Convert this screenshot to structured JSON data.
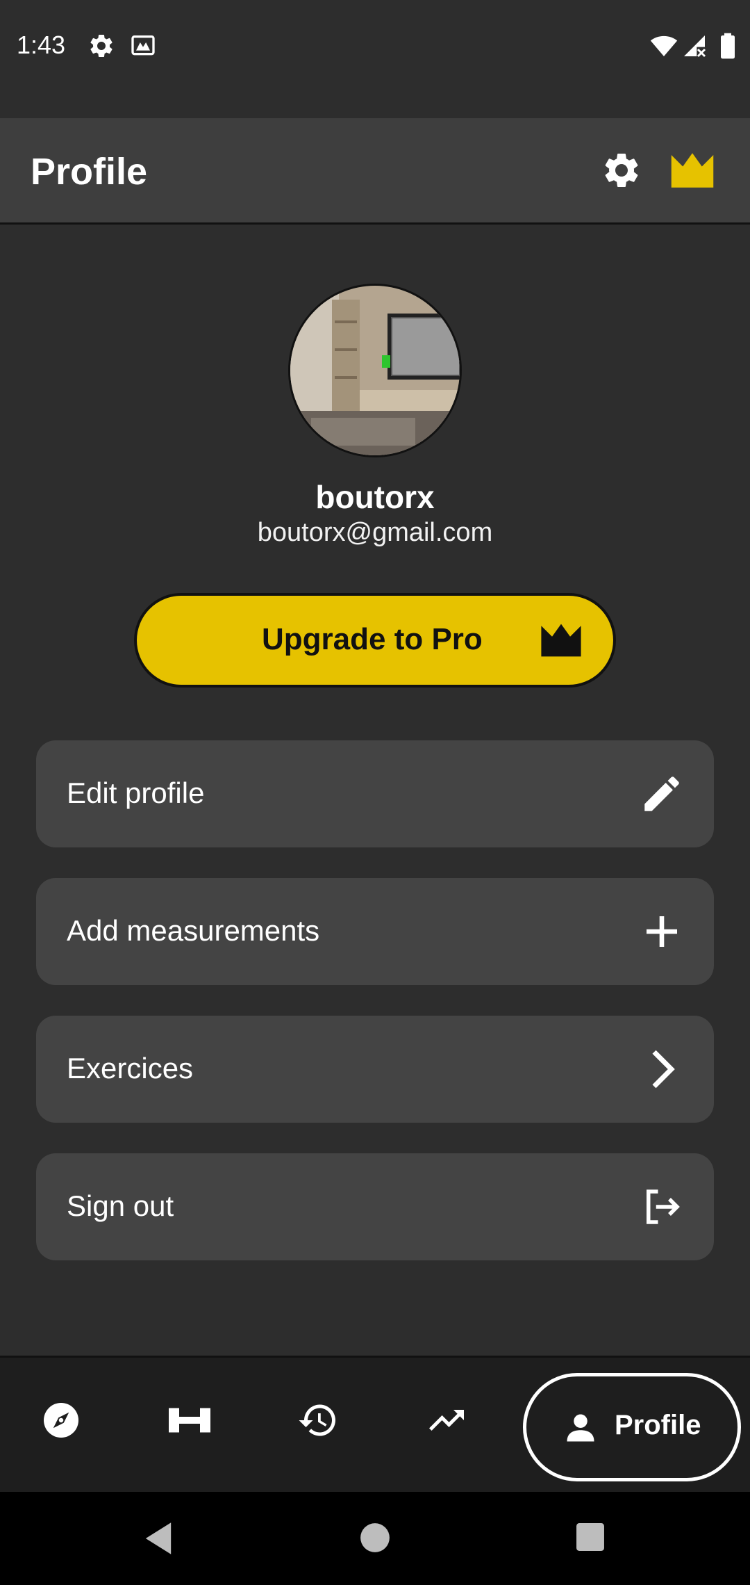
{
  "status_bar": {
    "time": "1:43",
    "icons": [
      "settings-icon",
      "gallery-icon",
      "wifi-icon",
      "signal-icon",
      "battery-icon"
    ]
  },
  "app_bar": {
    "title": "Profile",
    "actions": [
      "gear-icon",
      "crown-icon"
    ]
  },
  "profile": {
    "username": "boutorx",
    "email": "boutorx@gmail.com"
  },
  "upgrade": {
    "label": "Upgrade to Pro",
    "icon": "crown-icon"
  },
  "menu": {
    "items": [
      {
        "label": "Edit profile",
        "icon": "pencil-icon"
      },
      {
        "label": "Add measurements",
        "icon": "plus-icon"
      },
      {
        "label": "Exercices",
        "icon": "chevron-right-icon"
      },
      {
        "label": "Sign out",
        "icon": "logout-icon"
      }
    ]
  },
  "bottom_nav": {
    "items": [
      "compass-icon",
      "dumbbell-icon",
      "history-icon",
      "trending-up-icon"
    ],
    "active_label": "Profile",
    "active_icon": "person-icon"
  },
  "system_nav": [
    "back-button",
    "home-button",
    "recents-button"
  ],
  "colors": {
    "background": "#2d2d2d",
    "app_bar": "#3e3e3e",
    "card": "#444444",
    "accent": "#e6c200",
    "nav_bar": "#1e1e1e"
  }
}
